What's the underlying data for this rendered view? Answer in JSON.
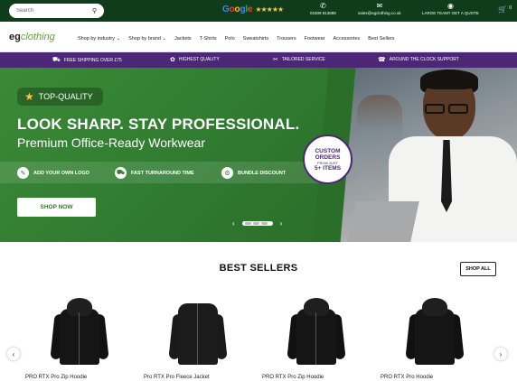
{
  "topbar": {
    "search_placeholder": "Search",
    "google_label": "Google",
    "google_stars": "★★★★★",
    "phone": "01509 813888",
    "email": "sales@egclothing.co.uk",
    "large_team": "LARGE TEAM? GET A QUOTE",
    "cart_count": "0"
  },
  "nav": {
    "logo_eg": "eg",
    "logo_clothing": "clothing",
    "items": [
      "Shop by industry ⌄",
      "Shop by brand ⌄",
      "Jackets",
      "T-Shirts",
      "Polo",
      "Sweatshirts",
      "Trousers",
      "Footwear",
      "Accessories",
      "Best Sellers"
    ]
  },
  "strip": {
    "items": [
      "FREE SHIPPING OVER £75",
      "HIGHEST QUALITY",
      "TAILORED SERVICE",
      "AROUND THE CLOCK SUPPORT"
    ]
  },
  "hero": {
    "badge": "TOP-QUALITY",
    "headline": "LOOK SHARP. STAY PROFESSIONAL.",
    "subheadline": "Premium Office-Ready Workwear",
    "features": [
      "ADD YOUR OWN LOGO",
      "FAST TURNAROUND TIME",
      "BUNDLE DISCOUNT"
    ],
    "cta": "SHOP NOW",
    "custom_line1": "CUSTOM",
    "custom_line2": "ORDERS",
    "custom_line3": "FROM JUST",
    "custom_line4": "5+ ITEMS"
  },
  "best_sellers": {
    "title": "BEST SELLERS",
    "shop_all": "SHOP ALL",
    "products": [
      {
        "name": "PRO RTX Pro Zip Hoodie"
      },
      {
        "name": "Pro RTX Pro Fleece Jacket"
      },
      {
        "name": "PRO RTX Pro Zip Hoodie"
      },
      {
        "name": "PRO RTX Pro Hoodie"
      }
    ]
  },
  "colors": {
    "topbar": "#0f3d1b",
    "strip": "#4b2775",
    "hero_green": "#2f7a30",
    "star": "#f6c545"
  }
}
